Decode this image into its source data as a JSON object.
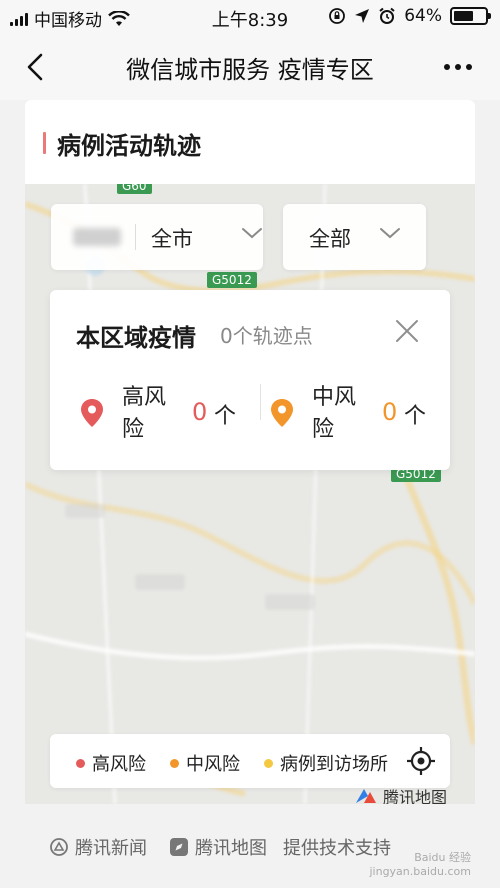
{
  "status_bar": {
    "carrier": "中国移动",
    "time": "上午8:39",
    "battery": "64%",
    "battery_level": 0.64
  },
  "nav": {
    "title": "微信城市服务 疫情专区"
  },
  "section": {
    "title": "病例活动轨迹"
  },
  "map": {
    "road_labels": [
      "G60",
      "G5012",
      "G5012"
    ]
  },
  "filters": {
    "city": "全市",
    "category": "全部"
  },
  "region": {
    "title": "本区域疫情",
    "track_points": "0个轨迹点",
    "high_risk": {
      "label": "高风险",
      "count": "0",
      "unit": "个",
      "color": "#e55b5b"
    },
    "mid_risk": {
      "label": "中风险",
      "count": "0",
      "unit": "个",
      "color": "#f2962b"
    }
  },
  "legend": {
    "items": [
      {
        "label": "高风险",
        "color": "#e55b5b"
      },
      {
        "label": "中风险",
        "color": "#f2962b"
      },
      {
        "label": "病例到访场所",
        "color": "#f5c842"
      }
    ],
    "locate_icon": "crosshair-icon"
  },
  "brand": "腾讯地图",
  "footer": {
    "tencent_news": "腾讯新闻",
    "tencent_map": "腾讯地图",
    "tech_support": "提供技术支持"
  },
  "watermark": {
    "line1": "Baidu 经验",
    "line2": "jingyan.baidu.com"
  }
}
